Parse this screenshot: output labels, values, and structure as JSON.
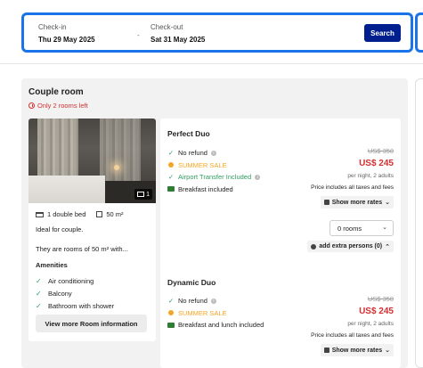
{
  "search": {
    "checkin_label": "Check-in",
    "checkin_value": "Thu 29 May 2025",
    "checkout_label": "Check-out",
    "checkout_value": "Sat 31 May 2025",
    "dash": "-",
    "search_button": "Search"
  },
  "room": {
    "title": "Couple room",
    "availability": "Only 2 rooms left",
    "photo_count": "1",
    "bed": "1 double bed",
    "size": "50 m²",
    "description_short": "Ideal for couple.",
    "description_long": "They are rooms of 50 m² with...",
    "amenities_title": "Amenities",
    "amenities": [
      "Air conditioning",
      "Balcony",
      "Bathroom with shower"
    ],
    "view_more": "View more Room information"
  },
  "rates": [
    {
      "name": "Perfect Duo",
      "features": [
        "No refund",
        "SUMMER SALE",
        "Airport Transfer Included",
        "Breakfast included"
      ],
      "old_price": "US$ 350",
      "price": "US$ 245",
      "per_night": "per night, 2 adults",
      "taxes": "Price includes all taxes and fees",
      "show_more": "Show more rates",
      "rooms_select": "0 rooms",
      "extra_persons": "add extra persons (0)"
    },
    {
      "name": "Dynamic Duo",
      "features": [
        "No refund",
        "SUMMER SALE",
        "Breakfast and lunch included"
      ],
      "old_price": "US$ 350",
      "price": "US$ 245",
      "per_night": "per night, 2 adults",
      "taxes": "Price includes all taxes and fees",
      "show_more": "Show more rates"
    }
  ],
  "colors": {
    "accent": "#1a73e8",
    "search_button": "#001f8f",
    "price": "#d32f2f",
    "sale": "#f5a623",
    "included": "#2e9e5e"
  }
}
